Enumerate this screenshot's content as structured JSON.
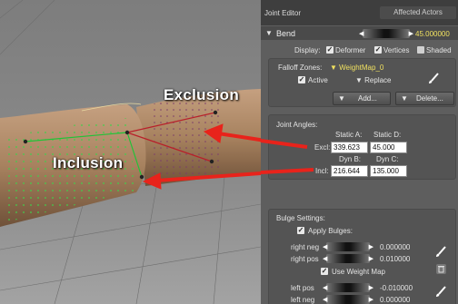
{
  "viewport": {
    "exclusion_label": "Exclusion",
    "inclusion_label": "Inclusion"
  },
  "panel": {
    "title": "Joint Editor",
    "tab_affected": "Affected Actors",
    "bend": {
      "name": "Bend",
      "value": "45.000000"
    },
    "display": {
      "label": "Display:",
      "deformer": "Deformer",
      "vertices": "Vertices",
      "shaded": "Shaded"
    },
    "falloff": {
      "label": "Falloff Zones:",
      "zone": "WeightMap_0",
      "active": "Active",
      "replace": "Replace",
      "add_label": "Add...",
      "delete_label": "Delete..."
    },
    "joint_angles": {
      "label": "Joint Angles:",
      "static_a": "Static A:",
      "static_d": "Static D:",
      "excl_label": "Excl:",
      "excl_a": "339.623",
      "excl_d": "45.000",
      "dyn_b": "Dyn B:",
      "dyn_c": "Dyn C:",
      "incl_label": "Incl:",
      "incl_b": "216.644",
      "incl_c": "135.000"
    },
    "bulge": {
      "label": "Bulge Settings:",
      "apply": "Apply Bulges:",
      "right_neg_label": "right neg",
      "right_neg_value": "0.000000",
      "right_pos_label": "right pos",
      "right_pos_value": "0.010000",
      "use_weight_map": "Use Weight Map",
      "left_pos_label": "left pos",
      "left_pos_value": "-0.010000",
      "left_neg_label": "left neg",
      "left_neg_value": "0.000000"
    }
  },
  "colors": {
    "arrow": "#e8231b",
    "exclusion_line": "#b8202a",
    "inclusion_line": "#22c238",
    "panel_bg": "#5e5e5e"
  }
}
